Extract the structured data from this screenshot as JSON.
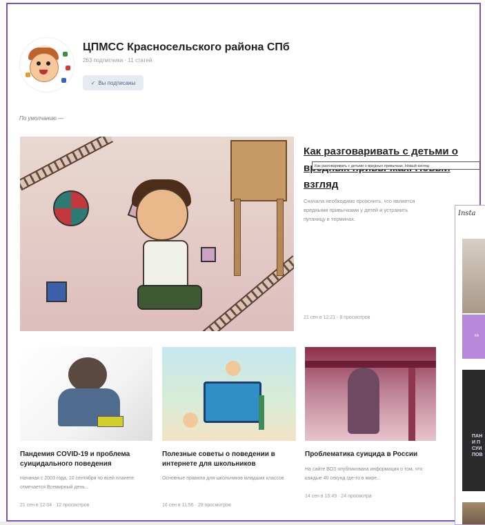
{
  "group": {
    "name": "ЦПМСС Красносельского района СПб",
    "meta": "263 подписчика · 11 статей",
    "subscribed_label": "Вы подписаны",
    "subscribed_check": "✓"
  },
  "sort_label": "По умолчанию —",
  "featured": {
    "title": "Как разговаривать с детьми о вредных привычках. Новый взгляд",
    "tooltip": "Как разговаривать с детьми о вредных привычках. Новый взгляд",
    "description": "Сначала необходимо прояснить, что является вредными привычками у детей и устранить путаницу в терминах.",
    "meta": "21 сен в 12:21 · 8 просмотров"
  },
  "articles": [
    {
      "title": "Пандемия COVID-19 и проблема суицидального поведения",
      "description": "Начиная с 2003 года, 10 сентября по всей планете отмечается Всемирный день...",
      "meta": "21 сен в 12:04 · 12 просмотров"
    },
    {
      "title": "Полезные советы о поведении в интернете для школьников",
      "description": "Основные правила для школьников младших классов",
      "meta": "16 сен в 11:56 · 28 просмотров"
    },
    {
      "title": "Проблематика суицида в России",
      "description": "На сайте ВОЗ опубликована информация о том, что каждые 40 секунд где-то в мире...",
      "meta": "14 сен в 15:49 · 24 просмотра"
    }
  ],
  "side_panel": {
    "header": "Insta",
    "card2_label": "КА",
    "card3_label": "ПАН\nИ П\nСУИ\nПОВ"
  },
  "colors": {
    "frame": "#7b52b8",
    "button_bg": "#e5ebf1",
    "button_text": "#55677d"
  }
}
